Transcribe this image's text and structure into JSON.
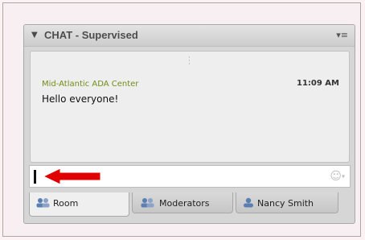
{
  "panel": {
    "title": "CHAT - Supervised",
    "collapse_icon": "triangle-down-icon",
    "menu_icon": "options-menu-icon"
  },
  "messages": [
    {
      "author": "Mid-Atlantic ADA Center",
      "time": "11:09 AM",
      "text": "Hello everyone!"
    }
  ],
  "input": {
    "value": "",
    "emoji_icon": "smiley-icon"
  },
  "tabs": [
    {
      "label": "Room",
      "icon": "group-icon",
      "active": true
    },
    {
      "label": "Moderators",
      "icon": "group-icon",
      "active": false
    },
    {
      "label": "Nancy Smith",
      "icon": "person-icon",
      "active": false
    }
  ],
  "colors": {
    "author": "#6f8f17",
    "arrow": "#e00000"
  }
}
